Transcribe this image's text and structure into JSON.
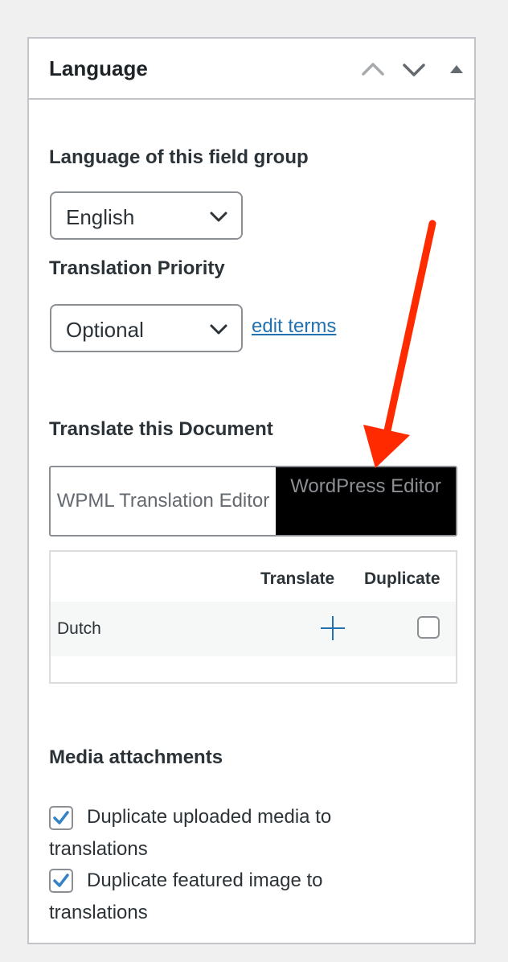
{
  "panel": {
    "title": "Language",
    "header_icons": [
      "chevron-up-icon",
      "chevron-down-icon",
      "triangle-up-icon"
    ]
  },
  "language_section": {
    "label": "Language of this field group",
    "selected": "English"
  },
  "priority_section": {
    "label": "Translation Priority",
    "selected": "Optional",
    "edit_link": "edit terms"
  },
  "translate_section": {
    "label": "Translate this Document",
    "tabs": [
      {
        "label": "WPML Translation Editor",
        "active": false
      },
      {
        "label": "WordPress Editor",
        "active": true
      }
    ],
    "table": {
      "headers": [
        "Translate",
        "Duplicate"
      ],
      "rows": [
        {
          "language": "Dutch",
          "translate_icon": "plus-icon",
          "duplicate_checked": false
        }
      ]
    }
  },
  "media_section": {
    "label": "Media attachments",
    "options": [
      {
        "label": "Duplicate uploaded media to translations",
        "checked": true
      },
      {
        "label": "Duplicate featured image to translations",
        "checked": true
      }
    ]
  },
  "colors": {
    "link": "#2271b1",
    "checkmark": "#3582c4",
    "annotation_arrow": "#ff2a00",
    "active_tab_bg": "#000000"
  }
}
